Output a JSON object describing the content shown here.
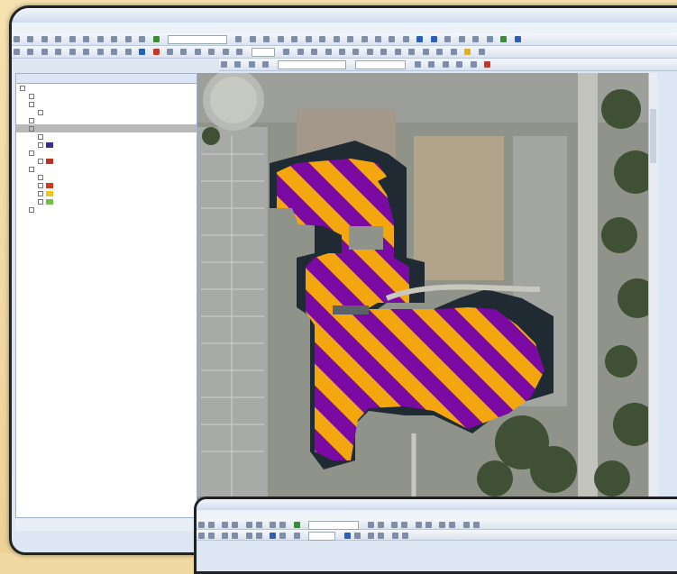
{
  "colors": {
    "hatch_purple": "#7a0aa3",
    "hatch_orange": "#f3a60e",
    "building_shadow": "#1f2a33",
    "aerial_ground": "#8d9286"
  },
  "main_window": {
    "title": "",
    "menus": [
      "",
      "",
      "",
      "",
      "",
      "",
      "",
      "",
      "",
      ""
    ],
    "toolbar_combo": "",
    "toolbar_combo2": ""
  },
  "toc": {
    "header": "",
    "layers": [
      {
        "label": "",
        "level": 0,
        "swatch": null
      },
      {
        "label": "",
        "level": 1,
        "swatch": null
      },
      {
        "label": "",
        "level": 1,
        "swatch": null
      },
      {
        "label": "",
        "level": 2,
        "swatch": null
      },
      {
        "label": "",
        "level": 1,
        "swatch": null
      },
      {
        "label": "",
        "level": 1,
        "swatch": null,
        "selected": true
      },
      {
        "label": "",
        "level": 2,
        "swatch": null
      },
      {
        "label": "",
        "level": 2,
        "swatch": "#3a2d8c"
      },
      {
        "label": "",
        "level": 1,
        "swatch": null
      },
      {
        "label": "",
        "level": 2,
        "swatch": "#c0301f"
      },
      {
        "label": "",
        "level": 1,
        "swatch": null
      },
      {
        "label": "",
        "level": 2,
        "swatch": null
      },
      {
        "label": "",
        "level": 2,
        "swatch": "#d23a20"
      },
      {
        "label": "",
        "level": 2,
        "swatch": "#f0c419"
      },
      {
        "label": "",
        "level": 2,
        "swatch": "#6fbf4a"
      },
      {
        "label": "",
        "level": 1,
        "swatch": null
      }
    ]
  },
  "status": {
    "left": ""
  },
  "second_window": {
    "title": "",
    "menus": [
      "",
      "",
      "",
      "",
      "",
      "",
      "",
      "",
      ""
    ]
  }
}
